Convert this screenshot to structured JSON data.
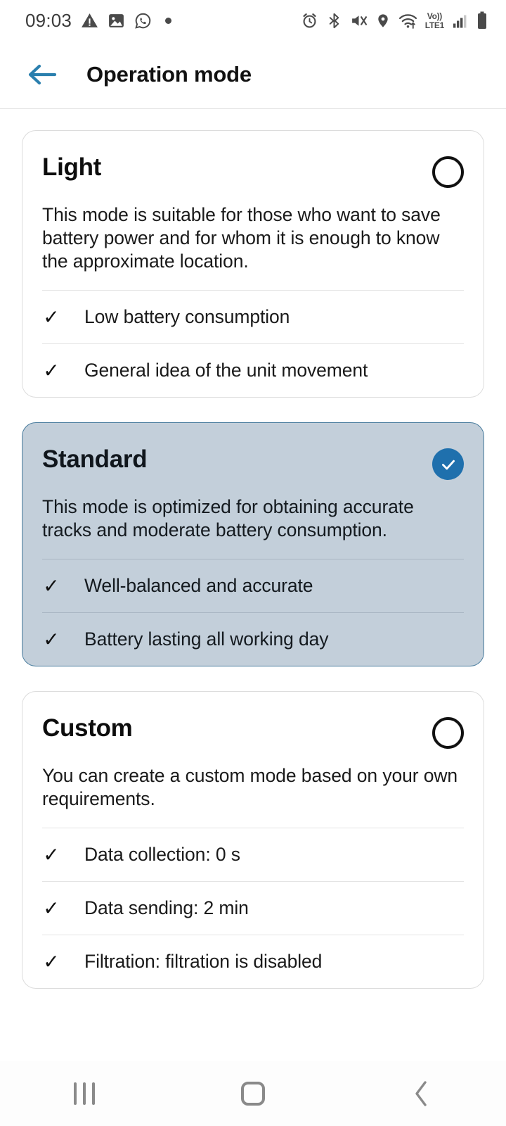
{
  "status_bar": {
    "time": "09:03",
    "left_icons": [
      "warning-triangle-icon",
      "image-icon",
      "whatsapp-icon",
      "dot-indicator"
    ],
    "right_icons": [
      "alarm-icon",
      "bluetooth-icon",
      "mute-icon",
      "location-icon",
      "wifi-icon"
    ],
    "volte": {
      "line1": "Vo))",
      "line2": "LTE1"
    },
    "signal": "signal-bars-icon",
    "battery": "battery-icon"
  },
  "app_bar": {
    "back_icon": "arrow-left-icon",
    "title": "Operation mode"
  },
  "colors": {
    "accent": "#1f70ad",
    "back_arrow": "#2a7fae",
    "selected_card_bg": "#c3cfda",
    "selected_card_border": "#4a7d9e",
    "card_border": "#dcdcdc",
    "page_bg": "#ffffff"
  },
  "modes": [
    {
      "title": "Light",
      "description": "This mode is suitable for those who want to save battery power and for whom it is enough to know the approximate location.",
      "selected": false,
      "features": [
        "Low battery consumption",
        "General idea of the unit movement"
      ]
    },
    {
      "title": "Standard",
      "description": "This mode is optimized for obtaining accurate tracks and moderate battery consumption.",
      "selected": true,
      "features": [
        "Well-balanced and accurate",
        "Battery lasting all working day"
      ]
    },
    {
      "title": "Custom",
      "description": "You can create a custom mode based on your own requirements.",
      "selected": false,
      "features": [
        "Data collection: 0 s",
        "Data sending: 2 min",
        "Filtration: filtration is disabled"
      ]
    }
  ],
  "check_glyph": "✓",
  "nav_bar": {
    "recents": "recents-icon",
    "home": "home-icon",
    "back": "back-chevron-icon"
  }
}
